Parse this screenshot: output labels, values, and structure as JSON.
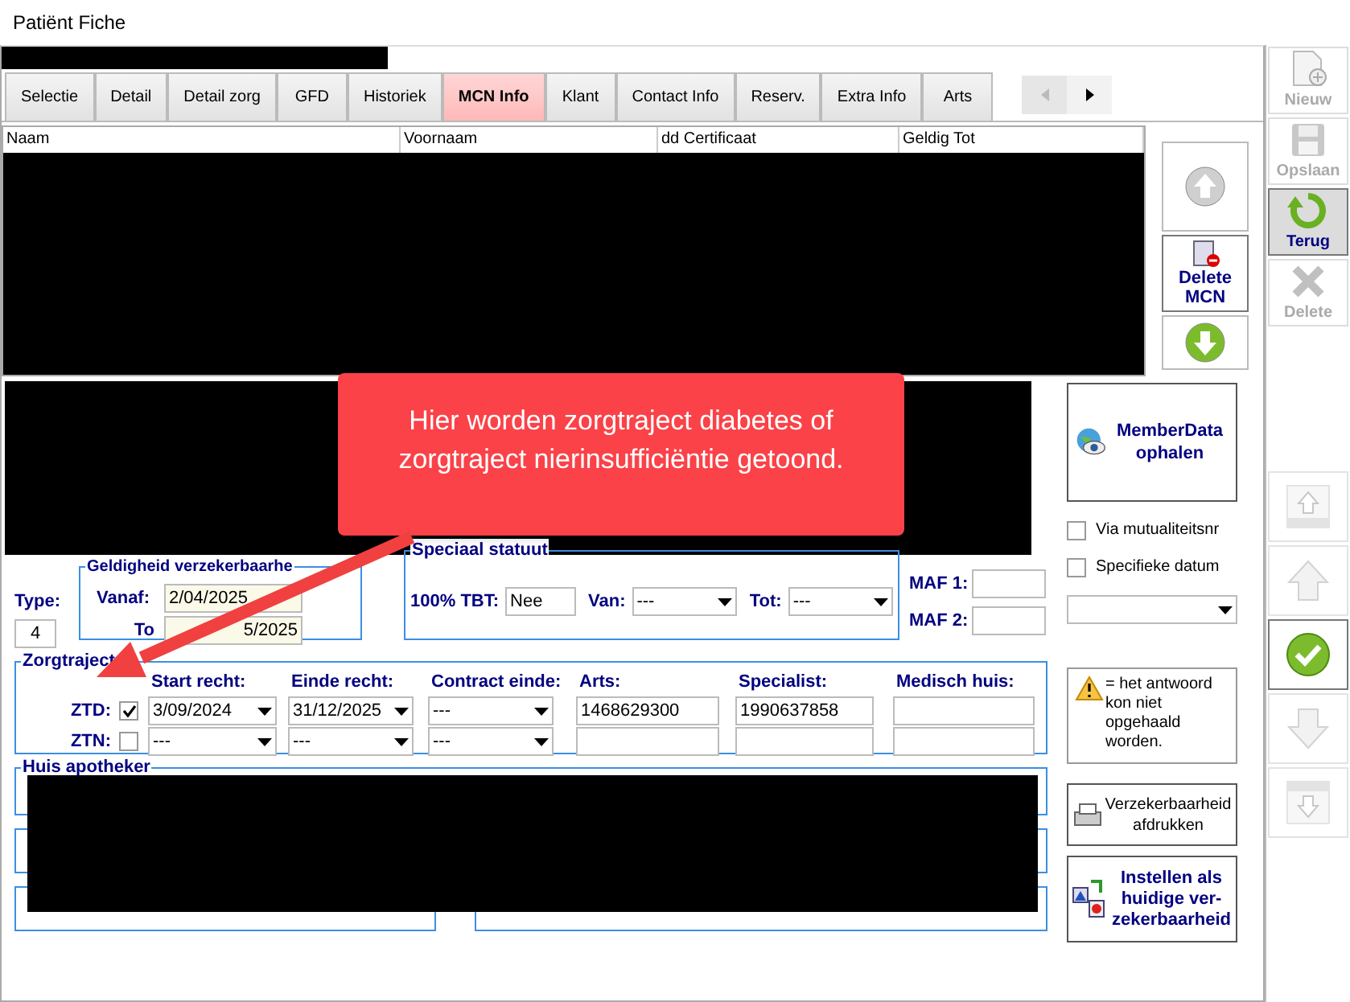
{
  "window": {
    "title": "Patiënt Fiche"
  },
  "tabs": [
    {
      "label": "Selectie",
      "selected": false
    },
    {
      "label": "Detail",
      "selected": false
    },
    {
      "label": "Detail zorg",
      "selected": false
    },
    {
      "label": "GFD",
      "selected": false
    },
    {
      "label": "Historiek",
      "selected": false
    },
    {
      "label": "MCN Info",
      "selected": true
    },
    {
      "label": "Klant",
      "selected": false
    },
    {
      "label": "Contact Info",
      "selected": false
    },
    {
      "label": "Reserv.",
      "selected": false
    },
    {
      "label": "Extra Info",
      "selected": false
    },
    {
      "label": "Arts",
      "selected": false
    }
  ],
  "mcn_table": {
    "columns": [
      "Naam",
      "Voornaam",
      "dd Certificaat",
      "Geldig Tot"
    ]
  },
  "mcn_buttons": [
    {
      "kind": "up",
      "disabled": true
    },
    {
      "kind": "delete",
      "label": "Delete MCN",
      "disabled": false
    },
    {
      "kind": "down",
      "disabled": false
    }
  ],
  "type": {
    "label": "Type:",
    "value": "4"
  },
  "geldigheid": {
    "legend": "Geldigheid verzekerbaarhe",
    "from_label": "Vanaf:",
    "from_value": "2/04/2025",
    "to_label": "To",
    "to_value": "5/2025"
  },
  "speciaal_statuut": {
    "legend": "Speciaal statuut",
    "tbt_label": "100% TBT:",
    "tbt_value": "Nee",
    "van_label": "Van:",
    "van_value": "---",
    "tot_label": "Tot:",
    "tot_value": "---"
  },
  "maf": [
    {
      "label": "MAF 1:"
    },
    {
      "label": "MAF 2:"
    }
  ],
  "zorgtrajecten": {
    "legend": "Zorgtraject",
    "columns": [
      "Start recht:",
      "Einde recht:",
      "Contract einde:",
      "Arts:",
      "Specialist:",
      "Medisch huis:"
    ],
    "rows": [
      {
        "label": "ZTD:",
        "checked": true,
        "start": "3/09/2024",
        "einde": "31/12/2025",
        "contract": "---",
        "arts": "1468629300",
        "specialist": "1990637858"
      },
      {
        "label": "ZTN:",
        "checked": false,
        "start": "---",
        "einde": "---",
        "contract": "---"
      }
    ]
  },
  "huis_apotheker": {
    "legend": "Huis apotheker"
  },
  "member_data_button": {
    "label": "MemberData ophalen"
  },
  "options": [
    {
      "label": "Via mutualiteitsnr",
      "checked": false
    },
    {
      "label": "Specifieke datum",
      "checked": false
    }
  ],
  "warning": {
    "text": "= het antwoord kon niet opgehaald worden."
  },
  "print_button": {
    "label": "Verzekerbaarheid afdrukken"
  },
  "set_current_button": {
    "label": "Instellen als huidige ver-zekerbaarheid"
  },
  "toolbar": [
    {
      "kind": "new",
      "label": "Nieuw",
      "disabled": true,
      "selected": false
    },
    {
      "kind": "save",
      "label": "Opslaan",
      "disabled": true,
      "selected": false
    },
    {
      "kind": "back",
      "label": "Terug",
      "disabled": false,
      "selected": true
    },
    {
      "kind": "delete",
      "label": "Delete",
      "disabled": true,
      "selected": false
    }
  ],
  "navigation": [
    {
      "kind": "first",
      "disabled": true,
      "selected": false
    },
    {
      "kind": "prev",
      "disabled": true,
      "selected": false
    },
    {
      "kind": "confirm",
      "disabled": false,
      "selected": true
    },
    {
      "kind": "next",
      "disabled": true,
      "selected": false
    },
    {
      "kind": "last",
      "disabled": true,
      "selected": false
    }
  ],
  "callout": {
    "text": "Hier worden zorgtraject diabetes of zorgtraject nierinsufficiëntie getoond."
  }
}
